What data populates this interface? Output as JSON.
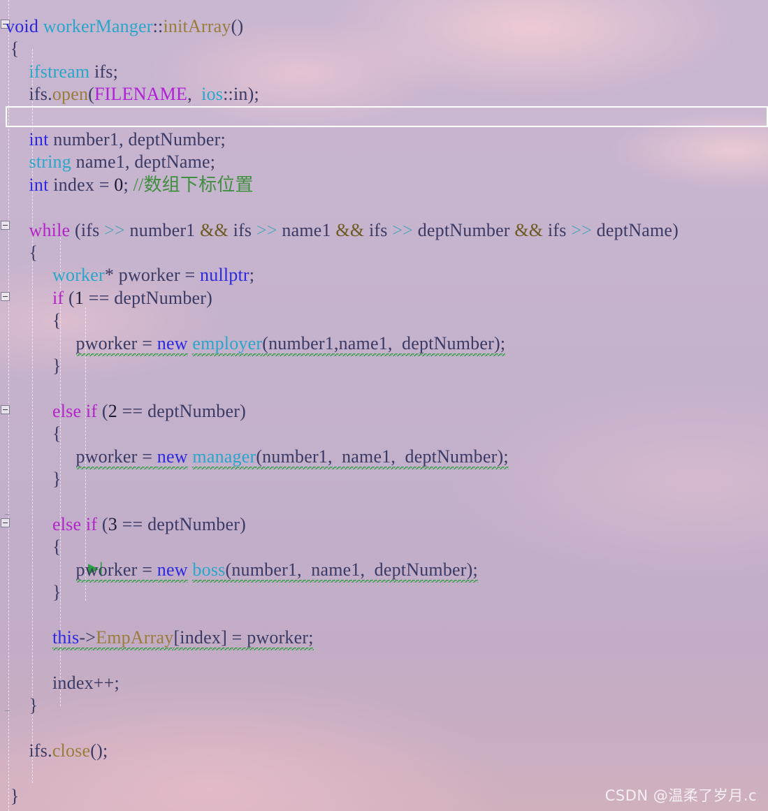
{
  "editor": {
    "language": "C++",
    "watermark": "CSDN @温柔了岁月.c",
    "colors": {
      "background_top": "#c9b6d0",
      "background_bottom": "#d0b0bf",
      "keyword": "#2b28e0",
      "control_keyword": "#b423c8",
      "type_name": "#2aa6c8",
      "function_name": "#9a7d3c",
      "macro": "#b020d8",
      "comment": "#3f8f3f",
      "operator": "#4fa6b8",
      "error_squiggle": "#2f9e3f",
      "current_line_border": "#ffffff"
    },
    "current_line_index": 4,
    "run_to_cursor_line_index": 22
  },
  "lines": [
    {
      "i": 0,
      "fold": "start",
      "segs": [
        {
          "t": "void ",
          "c": "kw"
        },
        {
          "t": "workerManger",
          "c": "typ"
        },
        {
          "t": "::",
          "c": "plain"
        },
        {
          "t": "initArray",
          "c": "fn"
        },
        {
          "t": "()",
          "c": "plain"
        }
      ]
    },
    {
      "i": 1,
      "segs": [
        {
          "t": " {",
          "c": "plain"
        }
      ]
    },
    {
      "i": 2,
      "segs": [
        {
          "t": "     ",
          "c": "plain"
        },
        {
          "t": "ifstream",
          "c": "typ"
        },
        {
          "t": " ifs;",
          "c": "plain"
        }
      ]
    },
    {
      "i": 3,
      "segs": [
        {
          "t": "     ifs.",
          "c": "plain"
        },
        {
          "t": "open",
          "c": "fn"
        },
        {
          "t": "(",
          "c": "plain"
        },
        {
          "t": "FILENAME",
          "c": "mac"
        },
        {
          "t": ",  ",
          "c": "plain"
        },
        {
          "t": "ios",
          "c": "typ"
        },
        {
          "t": "::",
          "c": "plain"
        },
        {
          "t": "in",
          "c": "plain"
        },
        {
          "t": ");",
          "c": "plain"
        }
      ]
    },
    {
      "i": 4,
      "segs": [
        {
          "t": "",
          "c": "plain"
        }
      ]
    },
    {
      "i": 5,
      "segs": [
        {
          "t": "     ",
          "c": "plain"
        },
        {
          "t": "int",
          "c": "kw"
        },
        {
          "t": " number1, deptNumber;",
          "c": "plain"
        }
      ]
    },
    {
      "i": 6,
      "segs": [
        {
          "t": "     ",
          "c": "plain"
        },
        {
          "t": "string",
          "c": "typ"
        },
        {
          "t": " name1, deptName;",
          "c": "plain"
        }
      ]
    },
    {
      "i": 7,
      "segs": [
        {
          "t": "     ",
          "c": "plain"
        },
        {
          "t": "int",
          "c": "kw"
        },
        {
          "t": " index = ",
          "c": "plain"
        },
        {
          "t": "0",
          "c": "num"
        },
        {
          "t": "; ",
          "c": "plain"
        },
        {
          "t": "//数组下标位置",
          "c": "cmt"
        }
      ]
    },
    {
      "i": 8,
      "segs": [
        {
          "t": "",
          "c": "plain"
        }
      ]
    },
    {
      "i": 9,
      "fold": "start",
      "segs": [
        {
          "t": "     ",
          "c": "plain"
        },
        {
          "t": "while",
          "c": "kw2"
        },
        {
          "t": " (ifs ",
          "c": "plain"
        },
        {
          "t": ">>",
          "c": "op"
        },
        {
          "t": " number1 ",
          "c": "plain"
        },
        {
          "t": "&&",
          "c": "amp"
        },
        {
          "t": " ifs ",
          "c": "plain"
        },
        {
          "t": ">>",
          "c": "op"
        },
        {
          "t": " name1 ",
          "c": "plain"
        },
        {
          "t": "&&",
          "c": "amp"
        },
        {
          "t": " ifs ",
          "c": "plain"
        },
        {
          "t": ">>",
          "c": "op"
        },
        {
          "t": " deptNumber ",
          "c": "plain"
        },
        {
          "t": "&&",
          "c": "amp"
        },
        {
          "t": " ifs ",
          "c": "plain"
        },
        {
          "t": ">>",
          "c": "op"
        },
        {
          "t": " deptName)",
          "c": "plain"
        }
      ]
    },
    {
      "i": 10,
      "segs": [
        {
          "t": "     {",
          "c": "plain"
        }
      ]
    },
    {
      "i": 11,
      "segs": [
        {
          "t": "          ",
          "c": "plain"
        },
        {
          "t": "worker",
          "c": "typ"
        },
        {
          "t": "* pworker = ",
          "c": "plain"
        },
        {
          "t": "nullptr",
          "c": "kw"
        },
        {
          "t": ";",
          "c": "plain"
        }
      ]
    },
    {
      "i": 12,
      "fold": "start",
      "segs": [
        {
          "t": "          ",
          "c": "plain"
        },
        {
          "t": "if",
          "c": "kw2"
        },
        {
          "t": " (",
          "c": "plain"
        },
        {
          "t": "1",
          "c": "num"
        },
        {
          "t": " == deptNumber)",
          "c": "plain"
        }
      ]
    },
    {
      "i": 13,
      "segs": [
        {
          "t": "          {",
          "c": "plain"
        }
      ]
    },
    {
      "i": 14,
      "err": true,
      "segs": [
        {
          "t": "               ",
          "c": "plain"
        },
        {
          "t": "pworker = ",
          "c": "plain"
        },
        {
          "t": "new",
          "c": "kw"
        },
        {
          "t": " ",
          "c": "plain"
        },
        {
          "t": "employer",
          "c": "typ"
        },
        {
          "t": "(number1,name1,  deptNumber);",
          "c": "plain"
        }
      ]
    },
    {
      "i": 15,
      "segs": [
        {
          "t": "          }",
          "c": "plain"
        }
      ]
    },
    {
      "i": 16,
      "segs": [
        {
          "t": "",
          "c": "plain"
        }
      ]
    },
    {
      "i": 17,
      "fold": "start",
      "segs": [
        {
          "t": "          ",
          "c": "plain"
        },
        {
          "t": "else if",
          "c": "kw2"
        },
        {
          "t": " (",
          "c": "plain"
        },
        {
          "t": "2",
          "c": "num"
        },
        {
          "t": " == deptNumber)",
          "c": "plain"
        }
      ]
    },
    {
      "i": 18,
      "segs": [
        {
          "t": "          {",
          "c": "plain"
        }
      ]
    },
    {
      "i": 19,
      "err": true,
      "segs": [
        {
          "t": "               ",
          "c": "plain"
        },
        {
          "t": "pworker = ",
          "c": "plain"
        },
        {
          "t": "new",
          "c": "kw"
        },
        {
          "t": " ",
          "c": "plain"
        },
        {
          "t": "manager",
          "c": "typ"
        },
        {
          "t": "(number1,  name1,  deptNumber);",
          "c": "plain"
        }
      ]
    },
    {
      "i": 20,
      "segs": [
        {
          "t": "          }",
          "c": "plain"
        }
      ]
    },
    {
      "i": 21,
      "segs": [
        {
          "t": "",
          "c": "plain"
        }
      ]
    },
    {
      "i": 22,
      "fold": "start",
      "segs": [
        {
          "t": "          ",
          "c": "plain"
        },
        {
          "t": "else if",
          "c": "kw2"
        },
        {
          "t": " (",
          "c": "plain"
        },
        {
          "t": "3",
          "c": "num"
        },
        {
          "t": " == deptNumber)",
          "c": "plain"
        }
      ]
    },
    {
      "i": 23,
      "segs": [
        {
          "t": "          {",
          "c": "plain"
        }
      ]
    },
    {
      "i": 24,
      "err": true,
      "marker": "run-to-cursor",
      "segs": [
        {
          "t": "               ",
          "c": "plain"
        },
        {
          "t": "pworker = ",
          "c": "plain"
        },
        {
          "t": "new",
          "c": "kw"
        },
        {
          "t": " ",
          "c": "plain"
        },
        {
          "t": "boss",
          "c": "typ"
        },
        {
          "t": "(number1,  name1,  deptNumber);",
          "c": "plain"
        }
      ]
    },
    {
      "i": 25,
      "segs": [
        {
          "t": "          }",
          "c": "plain"
        }
      ]
    },
    {
      "i": 26,
      "segs": [
        {
          "t": "",
          "c": "plain"
        }
      ]
    },
    {
      "i": 27,
      "err": true,
      "segs": [
        {
          "t": "          ",
          "c": "plain"
        },
        {
          "t": "this",
          "c": "kw"
        },
        {
          "t": "->",
          "c": "plain"
        },
        {
          "t": "EmpArray",
          "c": "fn"
        },
        {
          "t": "[index] = pworker;",
          "c": "plain"
        }
      ]
    },
    {
      "i": 28,
      "segs": [
        {
          "t": "",
          "c": "plain"
        }
      ]
    },
    {
      "i": 29,
      "segs": [
        {
          "t": "          index++;",
          "c": "plain"
        }
      ]
    },
    {
      "i": 30,
      "segs": [
        {
          "t": "     }",
          "c": "plain"
        }
      ]
    },
    {
      "i": 31,
      "segs": [
        {
          "t": "",
          "c": "plain"
        }
      ]
    },
    {
      "i": 32,
      "segs": [
        {
          "t": "     ifs.",
          "c": "plain"
        },
        {
          "t": "close",
          "c": "fn"
        },
        {
          "t": "();",
          "c": "plain"
        }
      ]
    },
    {
      "i": 33,
      "segs": [
        {
          "t": "",
          "c": "plain"
        }
      ]
    },
    {
      "i": 34,
      "segs": [
        {
          "t": " }",
          "c": "plain"
        }
      ]
    }
  ],
  "markers": {
    "run_to_cursor_glyph": "▶|"
  },
  "guides_x": [
    12,
    46,
    86,
    122
  ],
  "fold_boxes_y": [
    22,
    312,
    406,
    570,
    733
  ],
  "fold_ticks_y": [
    730,
    1010
  ]
}
